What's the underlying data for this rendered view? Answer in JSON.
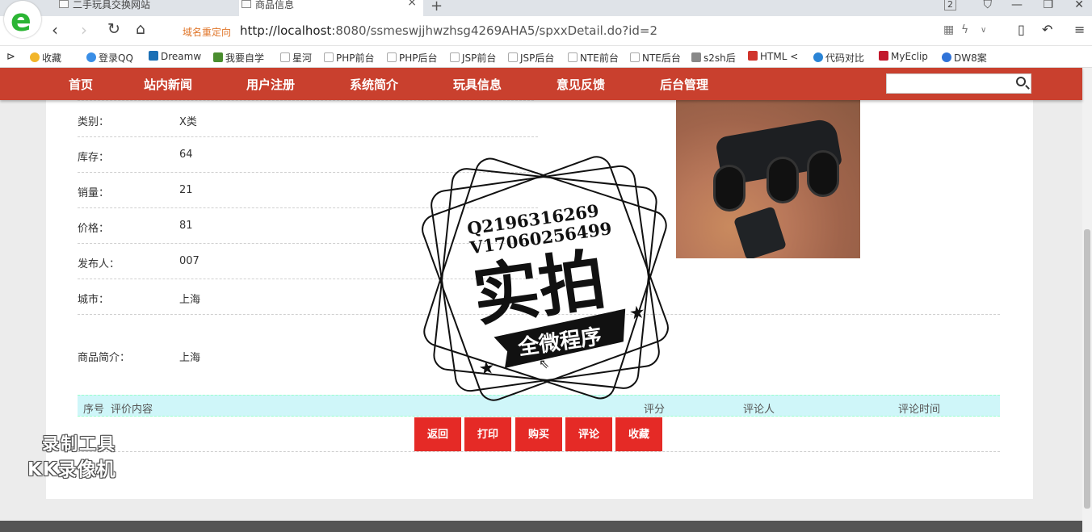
{
  "browser": {
    "tabs": [
      {
        "label": "二手玩具交换网站"
      },
      {
        "label": "商品信息"
      }
    ],
    "tab_count": "2",
    "redirect_label": "域名重定向",
    "url_host": "http://localhost",
    "url_rest": ":8080/ssmeswjjhwzhsg4269AHA5/spxxDetail.do?id=2",
    "bookmarks": [
      {
        "label": "收藏",
        "icon": "star-icon",
        "color": "#f2b52a"
      },
      {
        "label": "登录QQ",
        "icon": "qq-icon",
        "color": "#3a8ee6"
      },
      {
        "label": "Dreamw",
        "icon": "dreamweaver-icon",
        "color": "#1b6fb5"
      },
      {
        "label": "我要自学",
        "icon": "study-icon",
        "color": "#4a8d2f"
      },
      {
        "label": "星河",
        "icon": "page-icon",
        "color": "#bbbbbb"
      },
      {
        "label": "PHP前台",
        "icon": "page-icon",
        "color": "#bbbbbb"
      },
      {
        "label": "PHP后台",
        "icon": "page-icon",
        "color": "#bbbbbb"
      },
      {
        "label": "JSP前台",
        "icon": "page-icon",
        "color": "#bbbbbb"
      },
      {
        "label": "JSP后台",
        "icon": "page-icon",
        "color": "#bbbbbb"
      },
      {
        "label": "NTE前台",
        "icon": "page-icon",
        "color": "#bbbbbb"
      },
      {
        "label": "NTE后台",
        "icon": "page-icon",
        "color": "#bbbbbb"
      },
      {
        "label": "s2sh后",
        "icon": "image-icon",
        "color": "#888888"
      },
      {
        "label": "HTML <",
        "icon": "html-icon",
        "color": "#d0342c"
      },
      {
        "label": "代码对比",
        "icon": "compare-icon",
        "color": "#2a84d6"
      },
      {
        "label": "MyEclip",
        "icon": "myeclipse-icon",
        "color": "#c2182c"
      },
      {
        "label": "DW8案",
        "icon": "paw-icon",
        "color": "#3073d8"
      }
    ]
  },
  "nav": {
    "items": [
      "首页",
      "站内新闻",
      "用户注册",
      "系统简介",
      "玩具信息",
      "意见反馈",
      "后台管理"
    ],
    "search_placeholder": ""
  },
  "product": {
    "fields": [
      {
        "label": "类别：",
        "value": "X类"
      },
      {
        "label": "库存：",
        "value": "64"
      },
      {
        "label": "销量：",
        "value": "21"
      },
      {
        "label": "价格：",
        "value": "81"
      },
      {
        "label": "发布人：",
        "value": "007"
      },
      {
        "label": "城市：",
        "value": "上海"
      },
      {
        "label": "商品简介：",
        "value": "上海"
      }
    ]
  },
  "comments": {
    "headers": [
      "序号",
      "评价内容",
      "评分",
      "评论人",
      "评论时间"
    ]
  },
  "actions": [
    "返回",
    "打印",
    "购买",
    "评论",
    "收藏"
  ],
  "watermark": {
    "line1": "Q2196316269",
    "line2": "V17060256499",
    "main": "实拍",
    "banner": "全微程序",
    "recorder_line1": "录制工具",
    "recorder_line2": "KK录像机"
  },
  "colors": {
    "nav_bg": "#c9402e",
    "button_bg": "#e52a26",
    "table_head_bg": "#cff6f9"
  }
}
